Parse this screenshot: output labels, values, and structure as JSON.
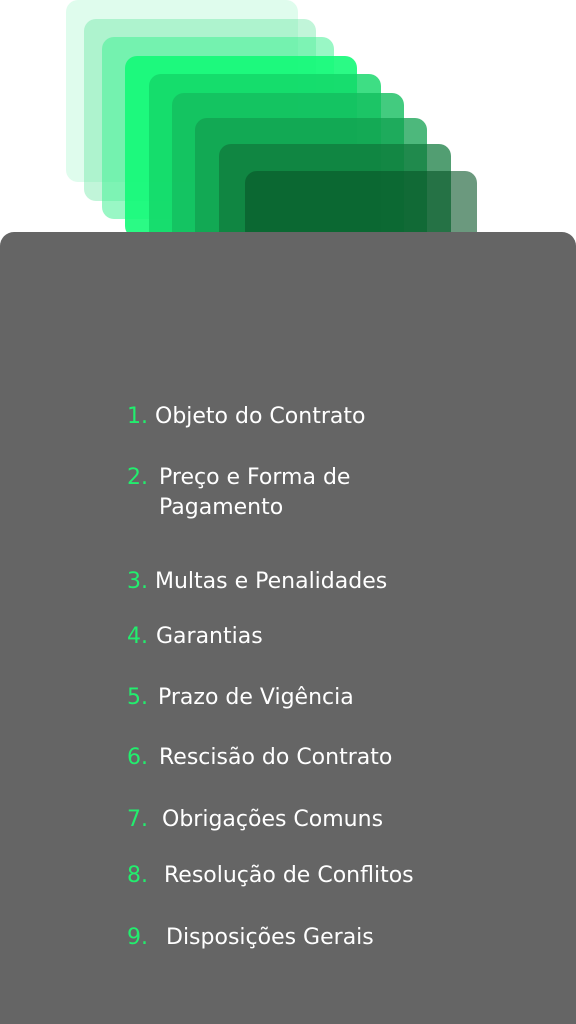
{
  "items": [
    {
      "number": "1.",
      "label": "Objeto do Contrato"
    },
    {
      "number": "2.",
      "label": "Preço e Forma de Pagamento"
    },
    {
      "number": "3.",
      "label": "Multas e Penalidades"
    },
    {
      "number": "4.",
      "label": "Garantias"
    },
    {
      "number": "5.",
      "label": "Prazo de Vigência"
    },
    {
      "number": "6.",
      "label": "Rescisão do Contrato"
    },
    {
      "number": "7.",
      "label": "Obrigações Comuns"
    },
    {
      "number": "8.",
      "label": "Resolução de Conflitos"
    },
    {
      "number": "9.",
      "label": "Disposições Gerais"
    }
  ],
  "colors": {
    "panel": "#656565",
    "accent": "#22ee6e",
    "text": "#ffffff"
  }
}
